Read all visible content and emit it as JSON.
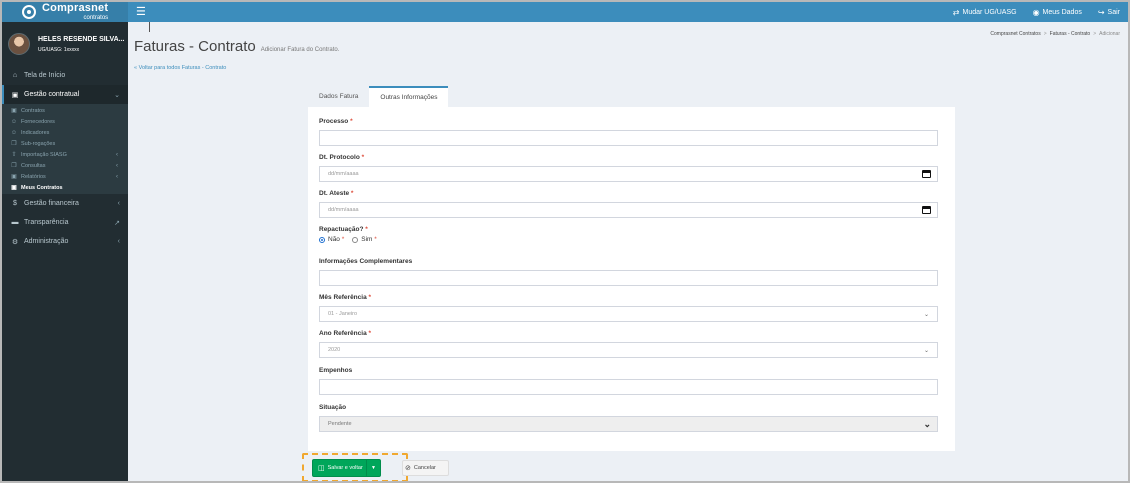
{
  "brand": {
    "name": "Comprasnet",
    "sub": "contratos"
  },
  "topbar": {
    "menu_icon": "hamburger-icon",
    "links": [
      {
        "label": "Mudar UG/UASG",
        "icon": "swap-icon"
      },
      {
        "label": "Meus Dados",
        "icon": "user-circle-icon"
      },
      {
        "label": "Sair",
        "icon": "sign-out-icon"
      }
    ]
  },
  "user": {
    "name": "HELES RESENDE SILVA...",
    "ug": "UG/UASG: 1xxxxx"
  },
  "sidebar": {
    "items": [
      {
        "label": "Tela de Início",
        "icon": "home-icon"
      },
      {
        "label": "Gestão contratual",
        "icon": "file-icon",
        "expanded": true
      },
      {
        "label": "Gestão financeira",
        "icon": "dollar-icon"
      },
      {
        "label": "Transparência",
        "icon": "monitor-icon"
      },
      {
        "label": "Administração",
        "icon": "cogs-icon"
      }
    ],
    "submenu": [
      {
        "label": "Contratos",
        "icon": "file-icon"
      },
      {
        "label": "Fornecedores",
        "icon": "users-icon"
      },
      {
        "label": "Indicadores",
        "icon": "users-icon"
      },
      {
        "label": "Sub-rogações",
        "icon": "copy-icon"
      },
      {
        "label": "Importação SIASG",
        "icon": "upload-icon"
      },
      {
        "label": "Consultas",
        "icon": "copy-icon"
      },
      {
        "label": "Relatórios",
        "icon": "file-icon"
      },
      {
        "label": "Meus Contratos",
        "icon": "file-icon"
      }
    ]
  },
  "page": {
    "title": "Faturas - Contrato",
    "subtitle": "Adicionar Fatura do Contrato.",
    "back_link": "« Voltar para todos Faturas - Contrato",
    "breadcrumb": [
      "Comprasnet Contratos",
      "Faturas - Contrato",
      "Adicionar"
    ]
  },
  "tabs": [
    {
      "label": "Dados Fatura",
      "active": false
    },
    {
      "label": "Outras Informações",
      "active": true
    }
  ],
  "form": {
    "processo": {
      "label": "Processo",
      "required": "*",
      "value": ""
    },
    "dt_protocolo": {
      "label": "Dt. Protocolo",
      "required": "*",
      "placeholder": "dd/mm/aaaa"
    },
    "dt_ateste": {
      "label": "Dt. Ateste",
      "required": "*",
      "placeholder": "dd/mm/aaaa"
    },
    "repactuacao": {
      "label": "Repactuação?",
      "required": "*",
      "options": [
        "Não",
        "Sim"
      ],
      "selected": "Não",
      "opt_required": "*"
    },
    "info_complementares": {
      "label": "Informações Complementares",
      "value": ""
    },
    "mes_referencia": {
      "label": "Mês Referência",
      "required": "*",
      "value": "01 - Janeiro"
    },
    "ano_referencia": {
      "label": "Ano Referência",
      "required": "*",
      "value": "2020"
    },
    "empenhos": {
      "label": "Empenhos",
      "value": ""
    },
    "situacao": {
      "label": "Situação",
      "value": "Pendente"
    }
  },
  "actions": {
    "save_label": "Salvar e voltar",
    "save_icon": "floppy-icon",
    "cancel_label": "Cancelar",
    "cancel_icon": "ban-icon"
  },
  "colors": {
    "header": "#3c8dbc",
    "logo": "#367fa9",
    "sidebar": "#222d32",
    "save": "#00a65a",
    "highlight": "#f0a830",
    "required": "#dd4b39"
  }
}
